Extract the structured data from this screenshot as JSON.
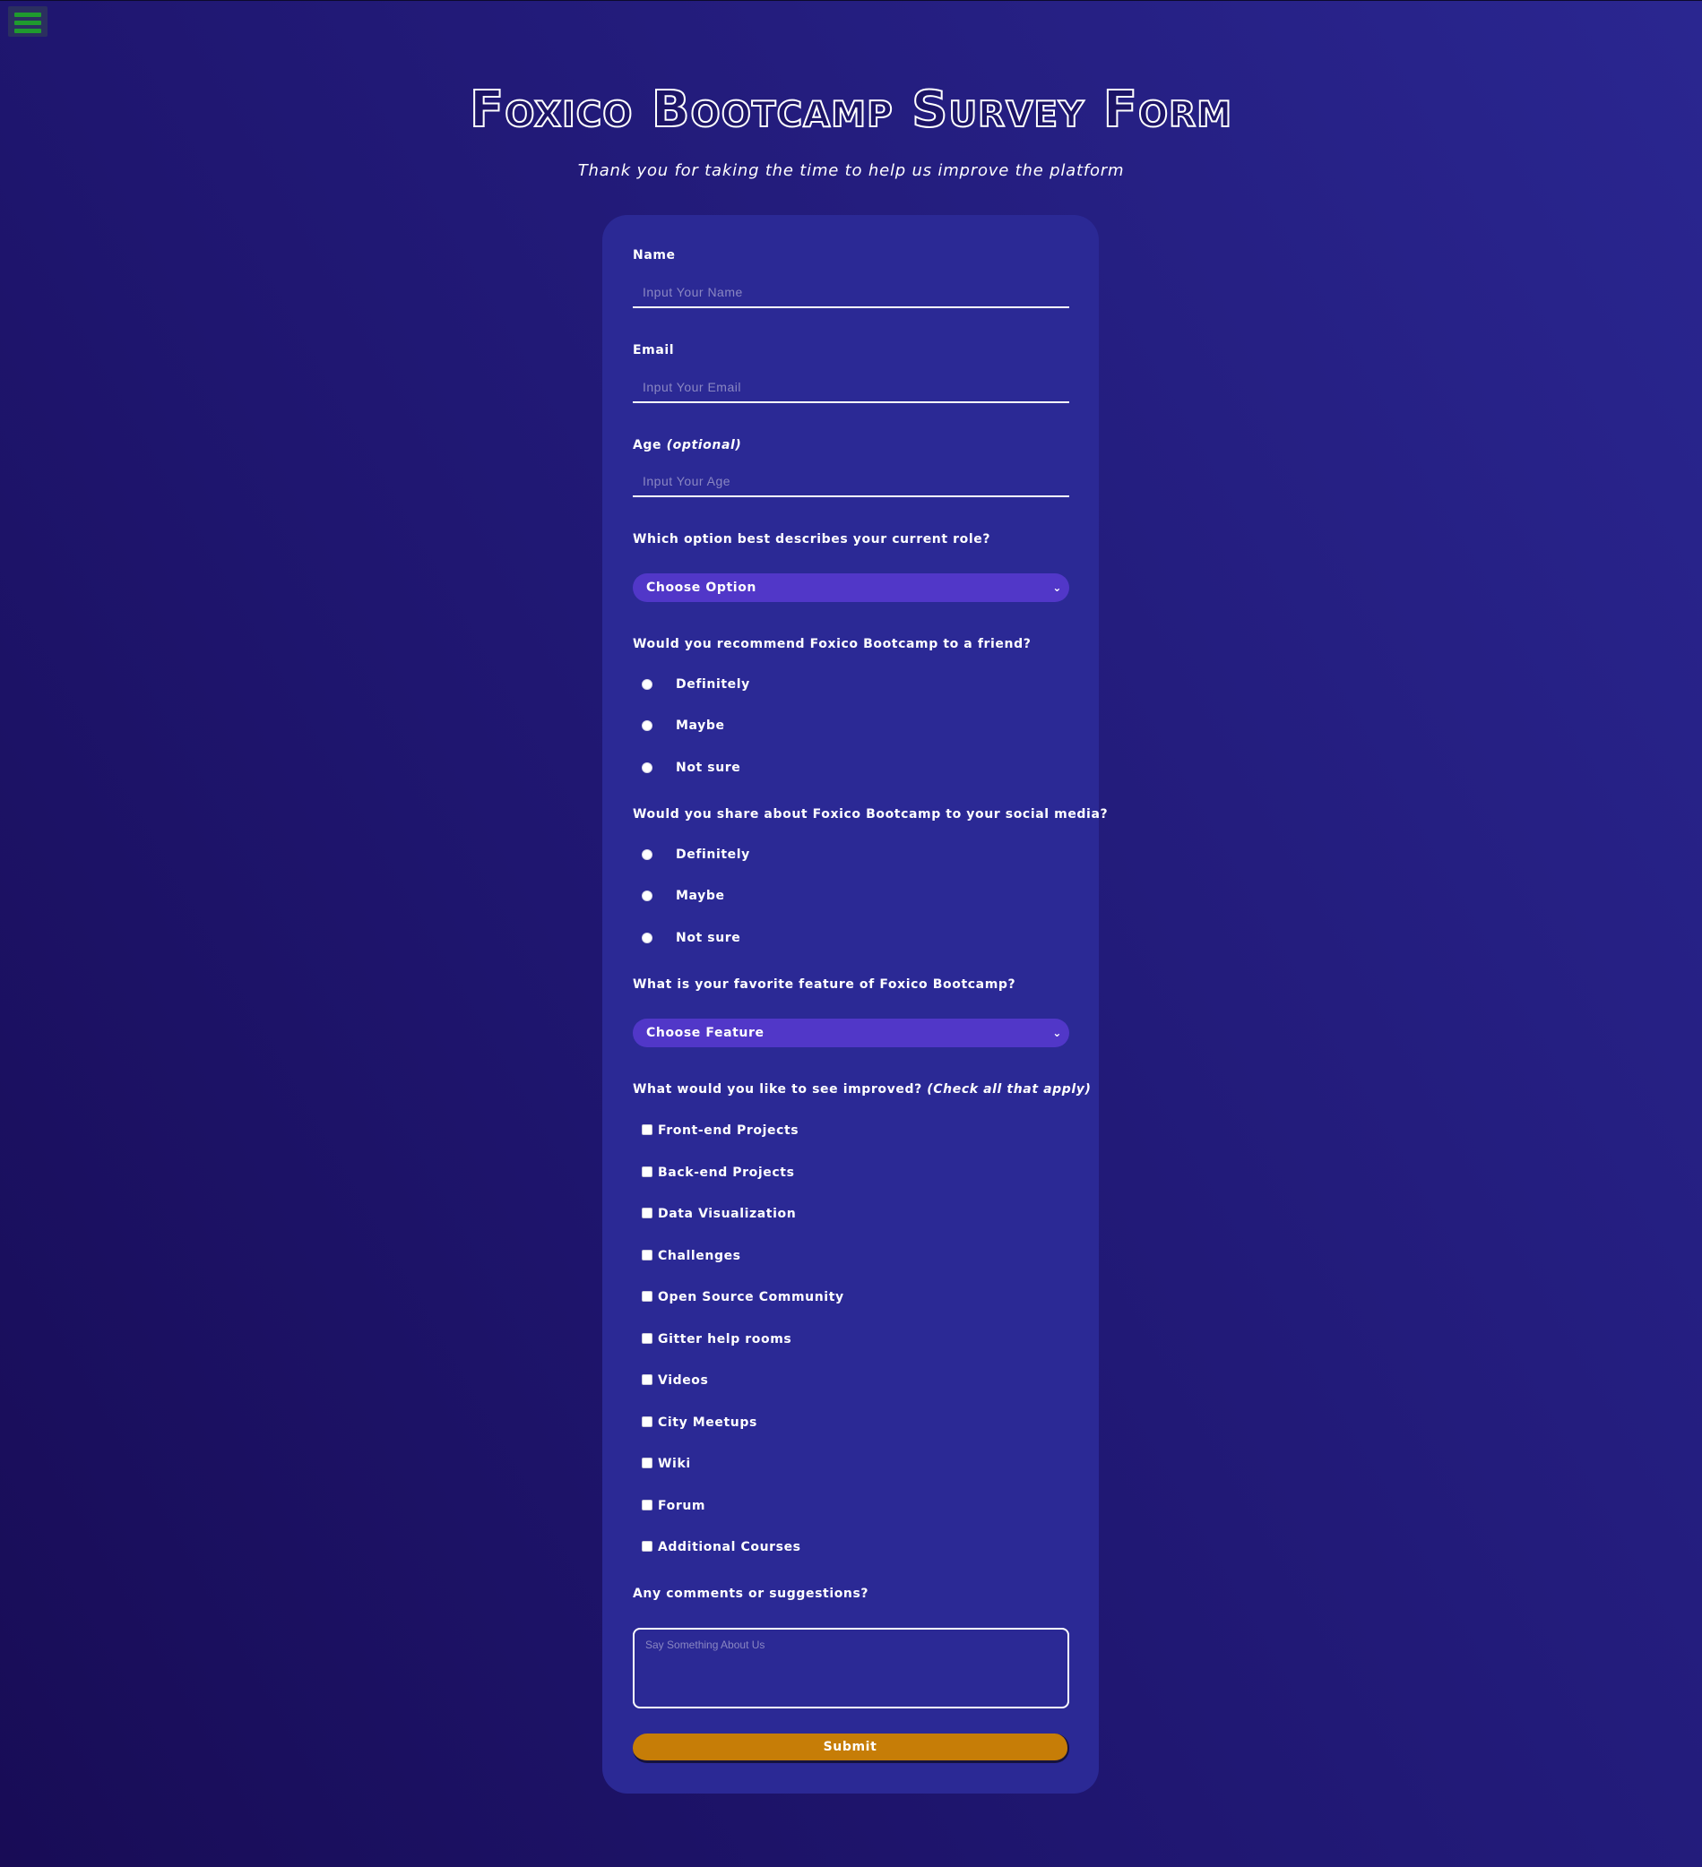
{
  "page": {
    "title": "Foxico Bootcamp Survey Form",
    "subtitle": "Thank you for taking the time to help us improve the platform",
    "menu_icon": "hamburger-menu-icon",
    "colors": {
      "background": "#1f1670",
      "card": "#2b2995",
      "select": "#5137c8",
      "submit": "#c67d07",
      "menu_bars": "#1f9b2e"
    }
  },
  "form": {
    "name": {
      "label": "Name",
      "placeholder": "Input Your Name"
    },
    "email": {
      "label": "Email",
      "placeholder": "Input Your Email"
    },
    "age": {
      "label": "Age",
      "label_note": "(optional)",
      "placeholder": "Input Your Age"
    },
    "role": {
      "label": "Which option best describes your current role?",
      "selected": "Choose Option"
    },
    "recommend": {
      "label": "Would you recommend Foxico Bootcamp to a friend?",
      "options": [
        "Definitely",
        "Maybe",
        "Not sure"
      ]
    },
    "share": {
      "label": "Would you share about Foxico Bootcamp to your social media?",
      "options": [
        "Definitely",
        "Maybe",
        "Not sure"
      ]
    },
    "feature": {
      "label": "What is your favorite feature of Foxico Bootcamp?",
      "selected": "Choose Feature"
    },
    "improve": {
      "label": "What would you like to see improved?",
      "label_note": "(Check all that apply)",
      "options": [
        "Front-end Projects",
        "Back-end Projects",
        "Data Visualization",
        "Challenges",
        "Open Source Community",
        "Gitter help rooms",
        "Videos",
        "City Meetups",
        "Wiki",
        "Forum",
        "Additional Courses"
      ]
    },
    "comments": {
      "label": "Any comments or suggestions?",
      "placeholder": "Say Something About Us"
    },
    "submit_label": "Submit"
  }
}
